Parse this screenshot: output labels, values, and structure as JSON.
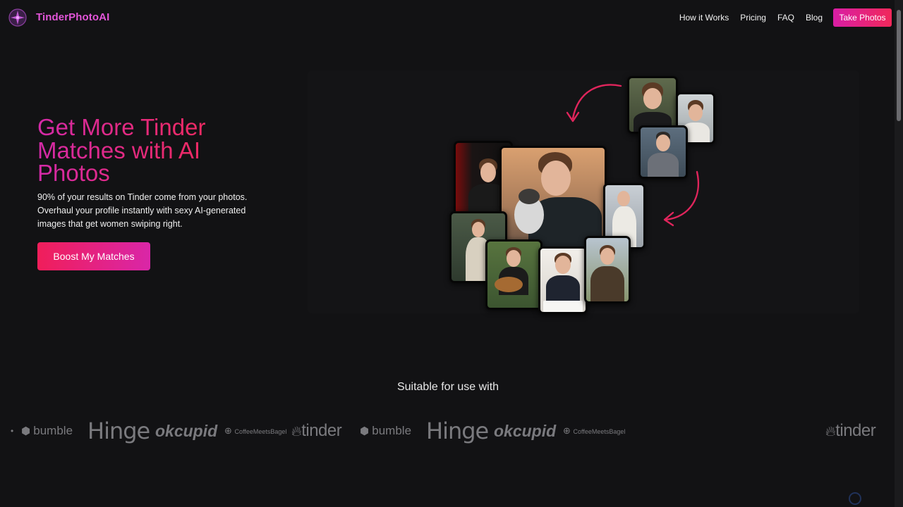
{
  "nav": {
    "brand": "TinderPhotoAI",
    "links": [
      "How it Works",
      "Pricing",
      "FAQ",
      "Blog"
    ],
    "cta_label": "Take Photos"
  },
  "hero": {
    "title": "Get More Tinder Matches with AI Photos",
    "subtitle": "90% of your results on Tinder come from your photos. Overhaul your profile instantly with sexy AI-generated images that get women swiping right.",
    "cta_label": "Boost My Matches"
  },
  "compat": {
    "heading": "Suitable for use with",
    "logos": [
      {
        "name": "bumble",
        "label": "bumble"
      },
      {
        "name": "hinge",
        "label": "Hinge"
      },
      {
        "name": "okcupid",
        "label": "okcupid"
      },
      {
        "name": "coffeemeetsbagel",
        "label": "CoffeeMeetsBagel"
      },
      {
        "name": "tinder",
        "label": "tinder"
      },
      {
        "name": "bumble",
        "label": "bumble"
      },
      {
        "name": "hinge",
        "label": "Hinge"
      },
      {
        "name": "okcupid",
        "label": "okcupid"
      },
      {
        "name": "coffeemeetsbagel",
        "label": "CoffeeMeetsBagel"
      },
      {
        "name": "tinder",
        "label": "tinder"
      }
    ]
  },
  "colors": {
    "background": "#121214",
    "brand": "#e255d8",
    "accent_start": "#d91ea5",
    "accent_end": "#f0285a",
    "logo_gray": "#7a7a7e"
  },
  "icons": {
    "logo": "sparkle-star-icon",
    "arrows": "curved-arrow-icon",
    "logo_dot": "bumble-hexagon-icon",
    "tinder_flame": "flame-icon",
    "cmb_mark": "cmb-icon"
  }
}
